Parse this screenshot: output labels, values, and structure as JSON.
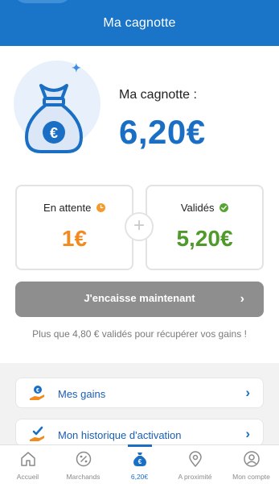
{
  "header": {
    "title": "Ma cagnotte"
  },
  "summary": {
    "label": "Ma cagnotte :",
    "amount": "6,20€"
  },
  "cards": {
    "pending": {
      "label": "En attente",
      "value": "1€",
      "status_color": "#f39a2b"
    },
    "validated": {
      "label": "Validés",
      "value": "5,20€",
      "status_color": "#56a433"
    }
  },
  "plus_symbol": "+",
  "cta": {
    "label": "J'encaisse maintenant",
    "chevron": "›"
  },
  "hint": "Plus que 4,80 € validés pour récupérer vos gains !",
  "menu": [
    {
      "label": "Mes gains",
      "icon": "hand-coin-icon",
      "chevron": "›"
    },
    {
      "label": "Mon historique d'activation",
      "icon": "hand-check-icon",
      "chevron": "›"
    }
  ],
  "tabs": [
    {
      "label": "Accueil",
      "icon": "home-icon"
    },
    {
      "label": "Marchands",
      "icon": "percent-badge-icon"
    },
    {
      "label": "6,20€",
      "icon": "money-bag-icon",
      "active": true
    },
    {
      "label": "A proximité",
      "icon": "location-pin-icon"
    },
    {
      "label": "Mon compte",
      "icon": "user-circle-icon"
    }
  ],
  "colors": {
    "brand": "#1a75c9",
    "amount": "#1a6fc4",
    "pending": "#f28a1d",
    "validated": "#4f9a2b",
    "cta_disabled": "#8e8e8e"
  }
}
